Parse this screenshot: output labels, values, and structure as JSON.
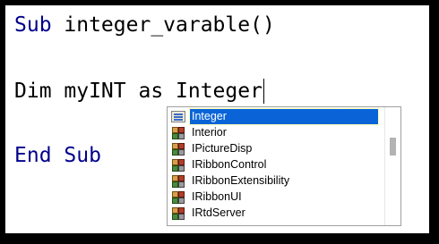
{
  "code": {
    "line1_keyword": "Sub",
    "line1_rest": " integer_varable()",
    "line2_text": "Dim myINT as Integer",
    "line3_keyword": "End Sub"
  },
  "autocomplete": {
    "items": [
      {
        "label": "Integer",
        "icon": "enum-icon",
        "selected": true
      },
      {
        "label": "Interior",
        "icon": "class-icon",
        "selected": false
      },
      {
        "label": "IPictureDisp",
        "icon": "class-icon",
        "selected": false
      },
      {
        "label": "IRibbonControl",
        "icon": "class-icon",
        "selected": false
      },
      {
        "label": "IRibbonExtensibility",
        "icon": "class-icon",
        "selected": false
      },
      {
        "label": "IRibbonUI",
        "icon": "class-icon",
        "selected": false
      },
      {
        "label": "IRtdServer",
        "icon": "class-icon",
        "selected": false
      }
    ],
    "scroll_position": 0.3
  },
  "colors": {
    "keyword": "#00008b",
    "selection": "#0a64d8"
  }
}
